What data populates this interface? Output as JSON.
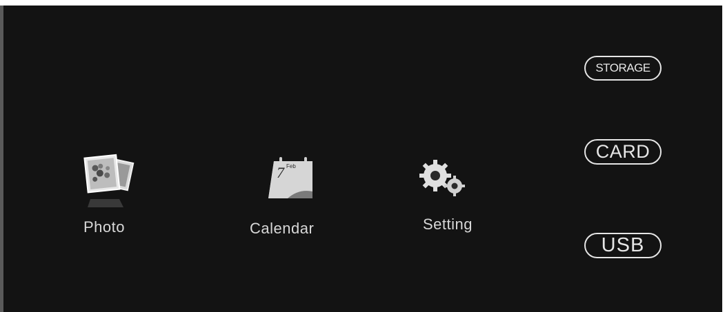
{
  "menu": {
    "photo": {
      "label": "Photo",
      "icon": "photo-icon"
    },
    "calendar": {
      "label": "Calendar",
      "icon": "calendar-icon",
      "day": "7",
      "month": "Feb"
    },
    "setting": {
      "label": "Setting",
      "icon": "gears-icon"
    }
  },
  "sources": {
    "storage": "STORAGE",
    "card": "CARD",
    "usb": "USB"
  },
  "colors": {
    "background": "#131313",
    "text": "#d8d8d8",
    "pill_border": "#e6e6e6"
  }
}
